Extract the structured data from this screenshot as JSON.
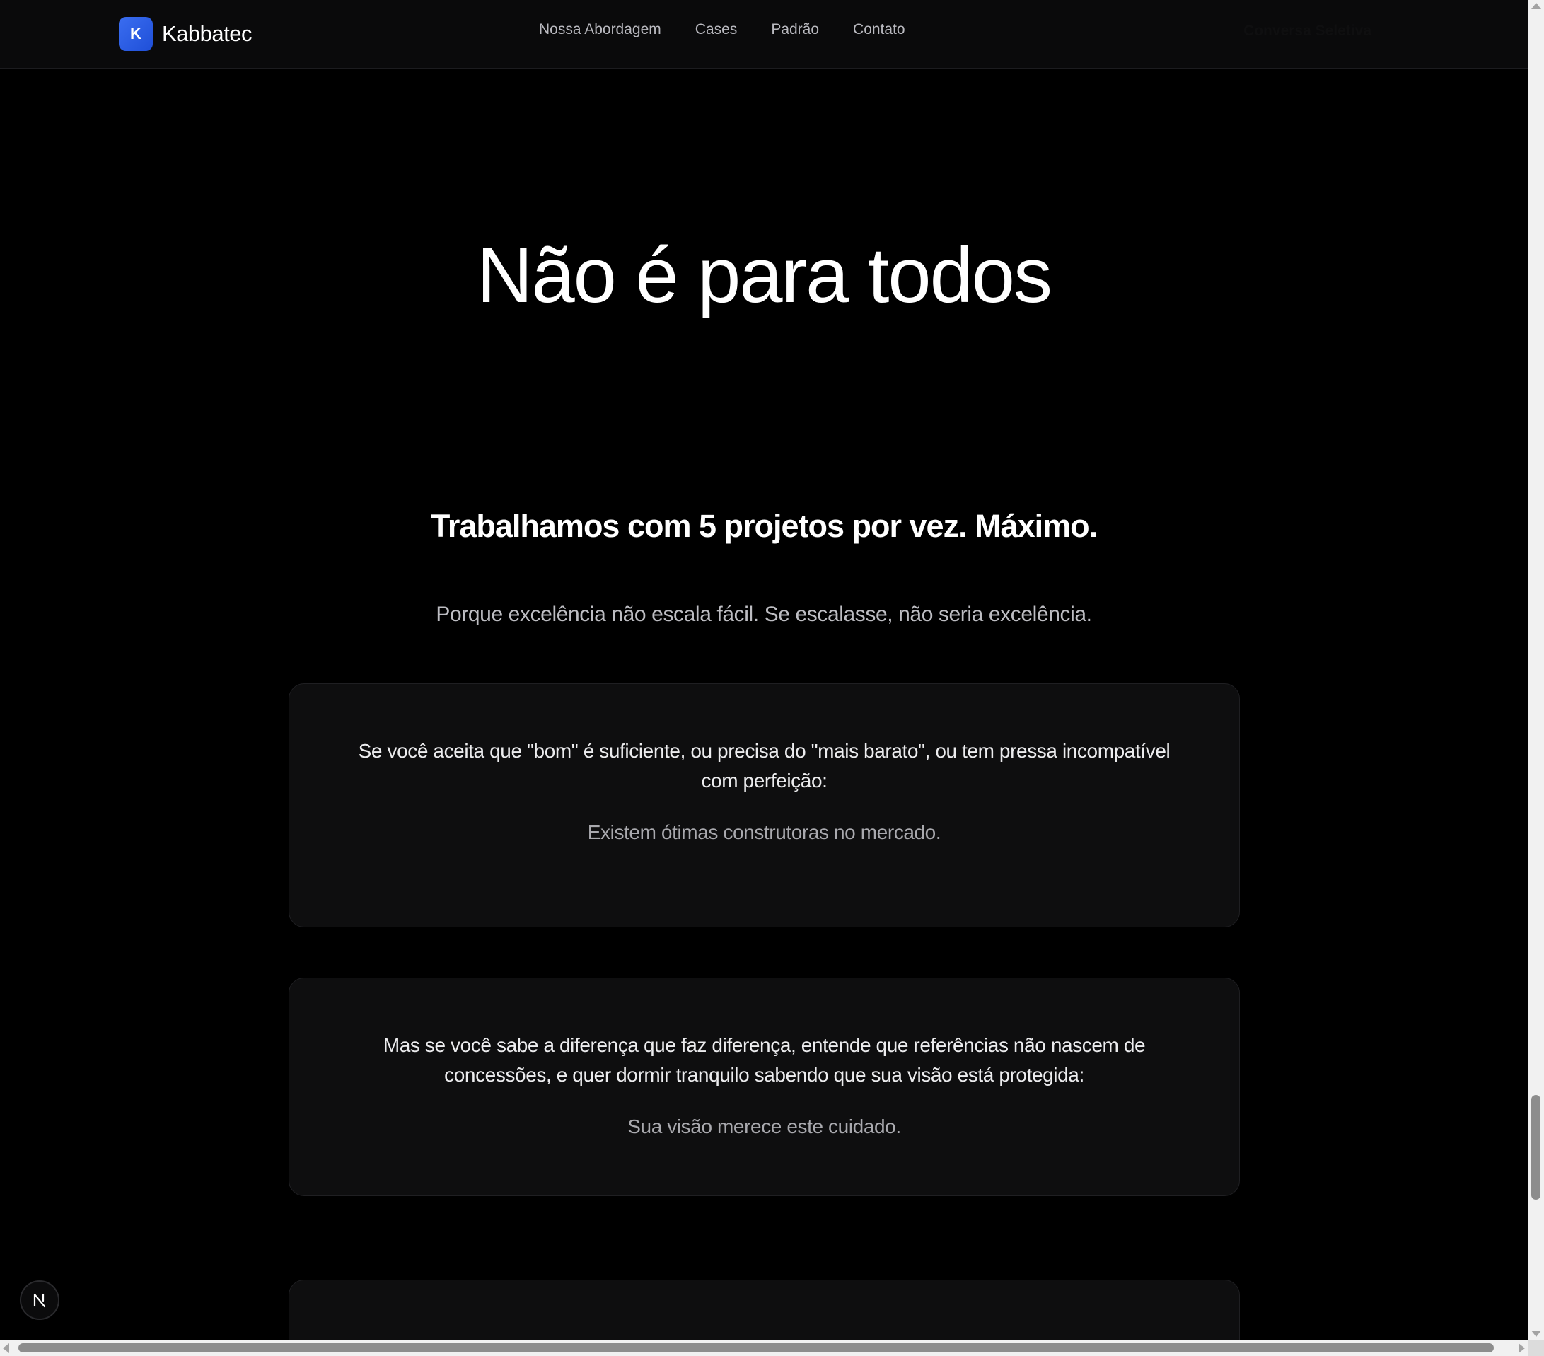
{
  "header": {
    "logo_letter": "K",
    "brand": "Kabbatec",
    "nav": [
      {
        "label": "Nossa Abordagem"
      },
      {
        "label": "Cases"
      },
      {
        "label": "Padrão"
      },
      {
        "label": "Contato"
      }
    ],
    "cta_label": "Conversa Seletiva"
  },
  "hero": {
    "title": "Não é para todos",
    "subtitle": "Trabalhamos com 5 projetos por vez. Máximo.",
    "lead": "Porque excelência não escala fácil. Se escalasse, não seria excelência."
  },
  "cards": [
    {
      "main": "Se você aceita que \"bom\" é suficiente, ou precisa do \"mais barato\", ou tem pressa incompatível com perfeição:",
      "sub": "Existem ótimas construtoras no mercado."
    },
    {
      "main": "Mas se você sabe a diferença que faz diferença, entende que referências não nascem de concessões, e quer dormir tranquilo sabendo que sua visão está protegida:",
      "sub": "Sua visão merece este cuidado."
    }
  ],
  "colors": {
    "background": "#000000",
    "header_bg": "#0a0a0b",
    "card_bg": "#0e0e0f",
    "logo_accent": "#2f5fe6"
  },
  "icons": {
    "floating_badge": "nextjs-n-icon"
  }
}
